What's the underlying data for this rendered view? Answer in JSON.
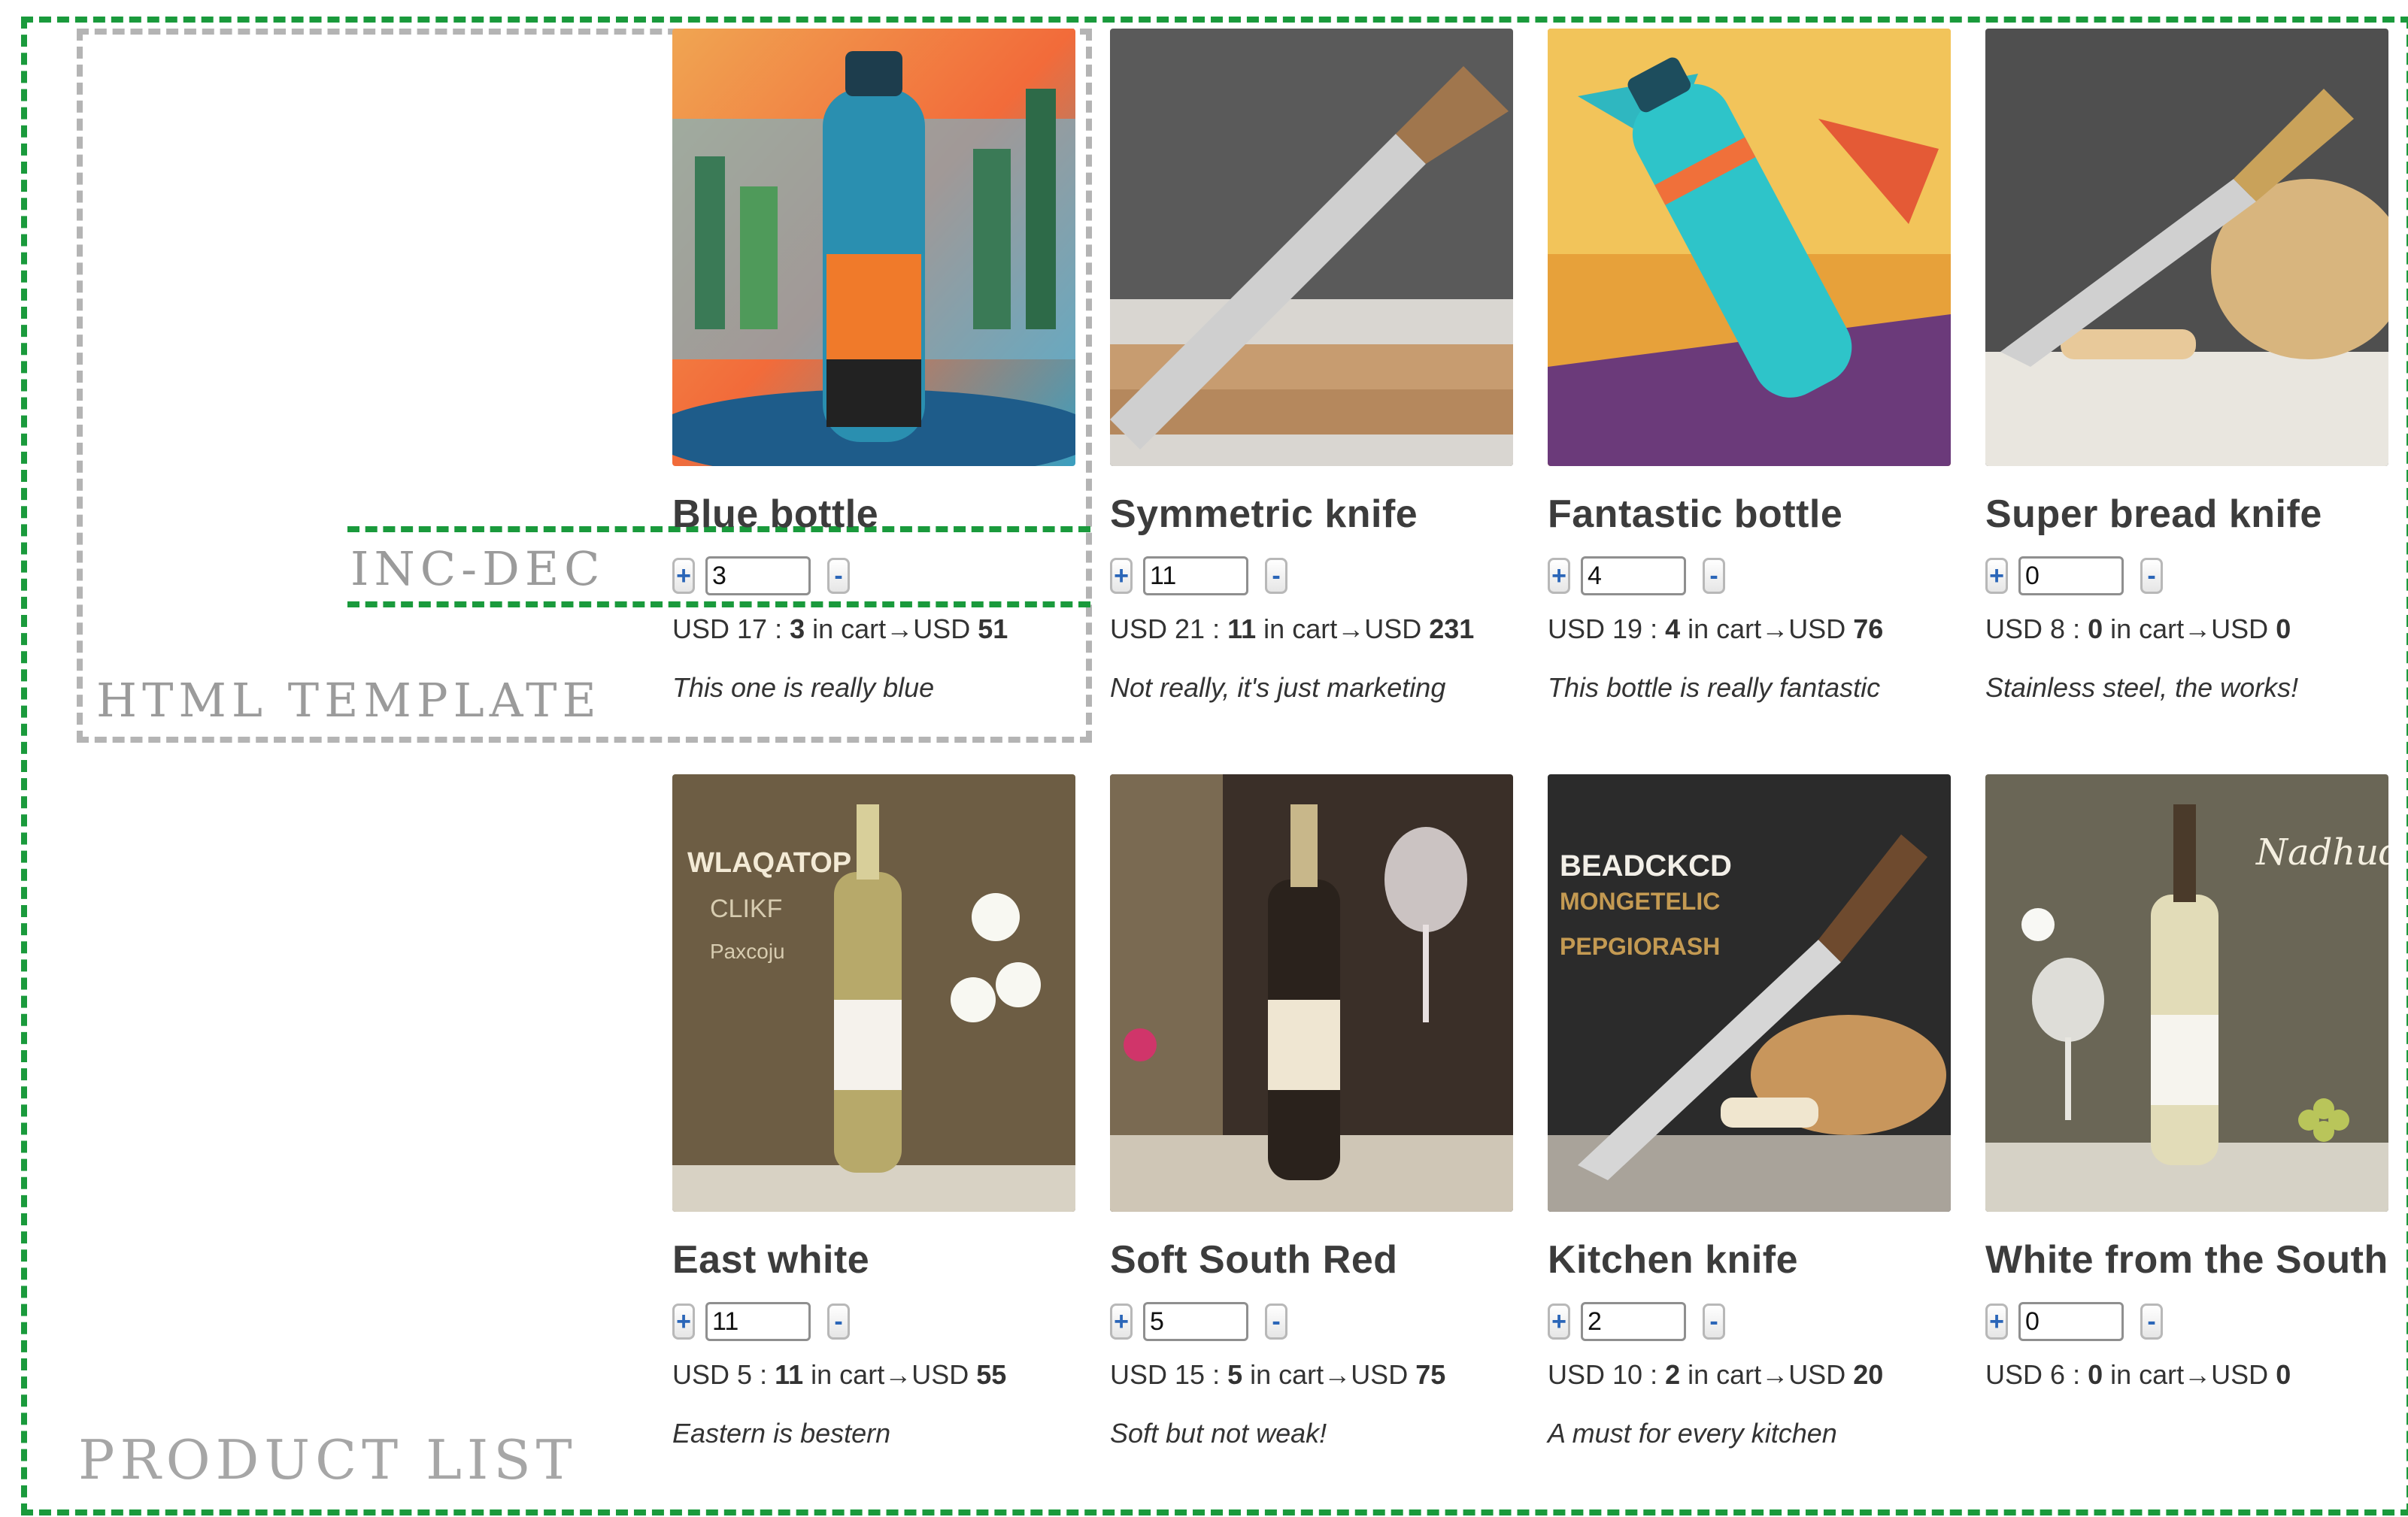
{
  "annotations": {
    "html_template": "HTML TEMPLATE",
    "inc_dec": "INC-DEC",
    "product_list": "PRODUCT LIST"
  },
  "labels": {
    "currency": "USD",
    "in_cart": "in cart",
    "arrow": "→",
    "plus": "+",
    "minus": "-"
  },
  "products": [
    {
      "name": "Blue bottle",
      "qty": "3",
      "price": "17",
      "total": "51",
      "desc": "This one is really blue"
    },
    {
      "name": "Symmetric knife",
      "qty": "11",
      "price": "21",
      "total": "231",
      "desc": "Not really, it's just marketing"
    },
    {
      "name": "Fantastic bottle",
      "qty": "4",
      "price": "19",
      "total": "76",
      "desc": "This bottle is really fantastic"
    },
    {
      "name": "Super bread knife",
      "qty": "0",
      "price": "8",
      "total": "0",
      "desc": "Stainless steel, the works!"
    },
    {
      "name": "East white",
      "qty": "11",
      "price": "5",
      "total": "55",
      "desc": "Eastern is bestern"
    },
    {
      "name": "Soft South Red",
      "qty": "5",
      "price": "15",
      "total": "75",
      "desc": "Soft but not weak!"
    },
    {
      "name": "Kitchen knife",
      "qty": "2",
      "price": "10",
      "total": "20",
      "desc": "A must for every kitchen"
    },
    {
      "name": "White from the South",
      "qty": "0",
      "price": "6",
      "total": "0",
      "desc": ""
    }
  ],
  "image_text": {
    "wine_east_label": "WLAQATOP",
    "wine_east_sub1": "CLIKF",
    "wine_east_sub2": "Paxcoju",
    "knife_poster_title": "BEADCKCD",
    "knife_poster_sub": "MONGETELIC",
    "knife_poster_sub2": "PEPGIORASH",
    "wine_white_script": "Nadhud"
  }
}
